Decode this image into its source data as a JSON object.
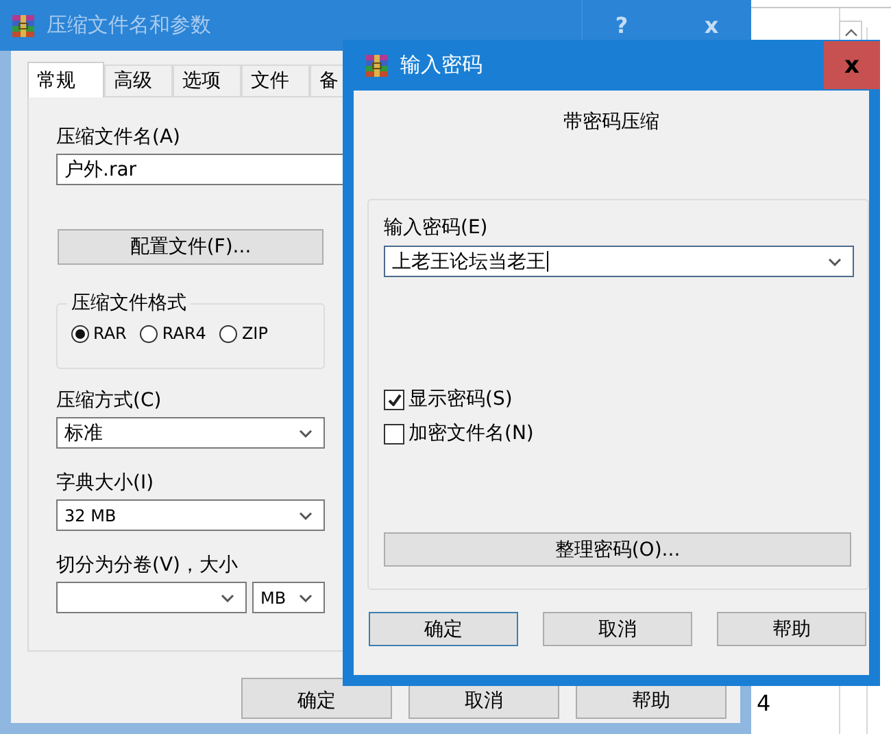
{
  "background_window": {
    "cell": "4"
  },
  "archive_window": {
    "title": "压缩文件名和参数",
    "help_button": "?",
    "close_button": "x",
    "tabs": [
      {
        "label": "常规",
        "selected": true
      },
      {
        "label": "高级",
        "selected": false
      },
      {
        "label": "选项",
        "selected": false
      },
      {
        "label": "文件",
        "selected": false
      },
      {
        "label": "备",
        "selected": false
      }
    ],
    "archive_name": {
      "label": "压缩文件名(A)",
      "value": "户外.rar"
    },
    "profiles_button": "配置文件(F)...",
    "format": {
      "label": "压缩文件格式",
      "options": [
        {
          "label": "RAR",
          "selected": true
        },
        {
          "label": "RAR4",
          "selected": false
        },
        {
          "label": "ZIP",
          "selected": false
        }
      ]
    },
    "method": {
      "label": "压缩方式(C)",
      "value": "标准"
    },
    "dictionary": {
      "label": "字典大小(I)",
      "value": "32 MB"
    },
    "split": {
      "label": "切分为分卷(V)，大小",
      "unit": "MB"
    },
    "buttons": [
      "确定",
      "取消",
      "帮助"
    ]
  },
  "password_dialog": {
    "title": "输入密码",
    "close_button": "x",
    "heading": "带密码压缩",
    "password": {
      "label": "输入密码(E)",
      "value": "上老王论坛当老王"
    },
    "options": [
      {
        "label": "显示密码(S)",
        "checked": true
      },
      {
        "label": "加密文件名(N)",
        "checked": false
      }
    ],
    "organize_button": "整理密码(O)...",
    "buttons": [
      {
        "label": "确定",
        "focused": true
      },
      {
        "label": "取消",
        "focused": false
      },
      {
        "label": "帮助",
        "focused": false
      }
    ]
  }
}
